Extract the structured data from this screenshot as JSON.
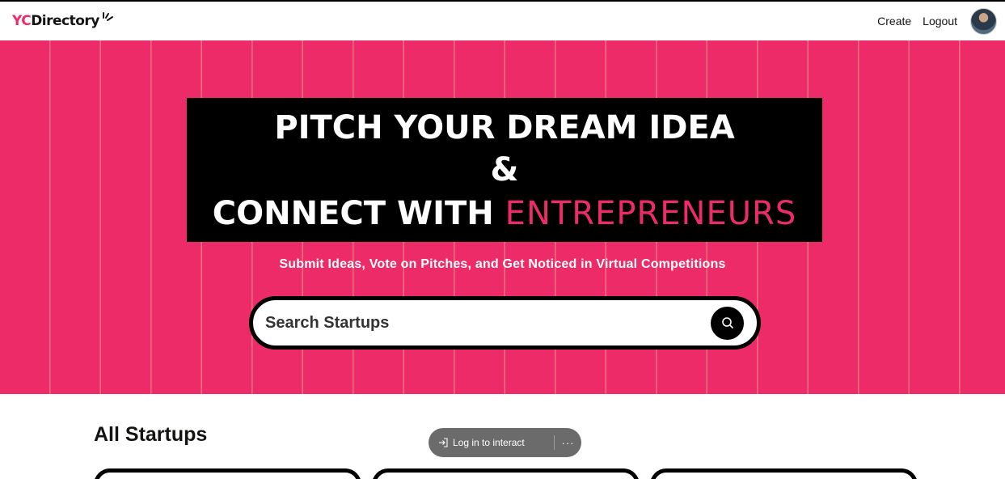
{
  "navbar": {
    "logo_prefix": "YC",
    "logo_suffix": "Directory",
    "links": [
      {
        "label": "Create"
      },
      {
        "label": "Logout"
      }
    ]
  },
  "hero": {
    "line1": "PITCH YOUR DREAM IDEA",
    "line2": "&",
    "line3_start": "CONNECT WITH ",
    "line3_accent": "ENTREPRENEURS",
    "subheading": "Submit Ideas, Vote on Pitches, and Get Noticed in Virtual Competitions",
    "search": {
      "placeholder": "Search Startups",
      "value": ""
    }
  },
  "section": {
    "title": "All Startups"
  },
  "overlay": {
    "login_label": "Log in to interact",
    "more_label": "···"
  },
  "colors": {
    "brand_pink": "#EE2B69",
    "black": "#000000"
  },
  "icons": {
    "logo_mark": "sparkle-icon",
    "search": "search-icon",
    "login": "login-icon"
  }
}
